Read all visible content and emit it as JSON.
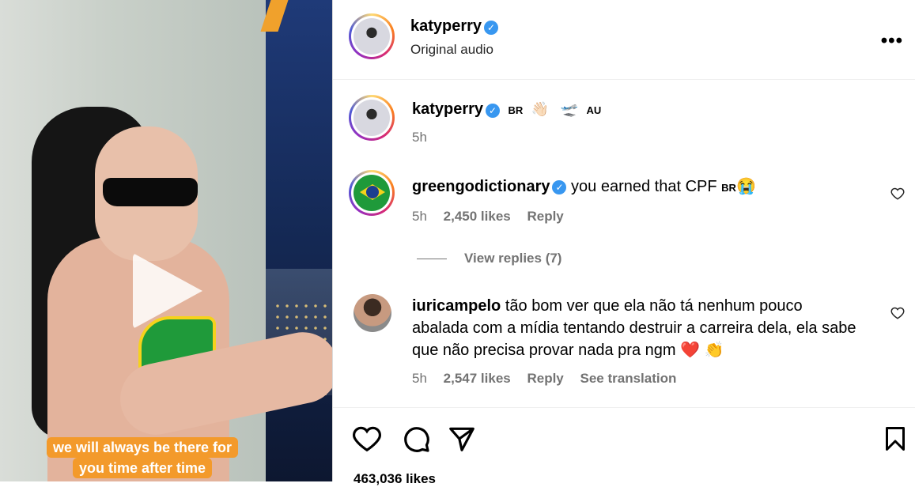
{
  "video": {
    "caption_line1": "we will always be there for",
    "caption_line2": "you time after time"
  },
  "header": {
    "username": "katyperry",
    "subtitle": "Original audio"
  },
  "caption": {
    "username": "katyperry",
    "text_br": "BR",
    "text_au": "AU",
    "time": "5h"
  },
  "comments": [
    {
      "username": "greengodictionary",
      "text": "you earned that CPF",
      "flag": "BR",
      "emoji": "😭",
      "time": "5h",
      "likes": "2,450 likes",
      "reply": "Reply",
      "view_replies": "View replies (7)"
    },
    {
      "username": "iuricampelo",
      "line1": "tão bom ver que ela não tá nenhum pouco",
      "line2": "abalada com a mídia tentando destruir a carreira dela, ela sabe",
      "line3": "que não precisa provar nada pra ngm",
      "emoji": "❤️ 👏",
      "time": "5h",
      "likes": "2,547 likes",
      "reply": "Reply",
      "translate": "See translation"
    }
  ],
  "footer": {
    "likes": "463,036 likes"
  },
  "icons": {
    "more": "more-options-icon",
    "heart": "heart-icon",
    "comment": "comment-icon",
    "share": "share-icon",
    "save": "bookmark-icon"
  }
}
